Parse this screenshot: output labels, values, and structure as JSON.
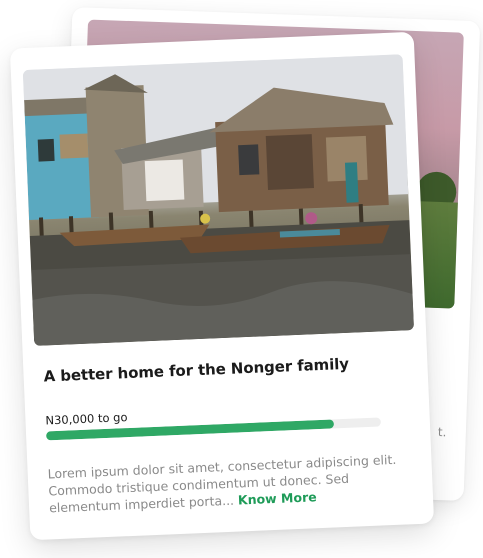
{
  "card": {
    "title": "A better home for the Nonger family",
    "goal_text": "N30,000 to go",
    "progress": 0.86,
    "description": "Lorem ipsum dolor sit amet, consectetur adipiscing elit. Commodo tristique condimentum ut donec. Sed elementum imperdiet porta...",
    "link_label": "Know More"
  },
  "back_card": {
    "partial_text": "t."
  },
  "colors": {
    "accent": "#2fa865",
    "link": "#1e9b58",
    "muted_text": "#8a8a8a",
    "title_text": "#1b1b1b",
    "track": "#eeeeee"
  }
}
